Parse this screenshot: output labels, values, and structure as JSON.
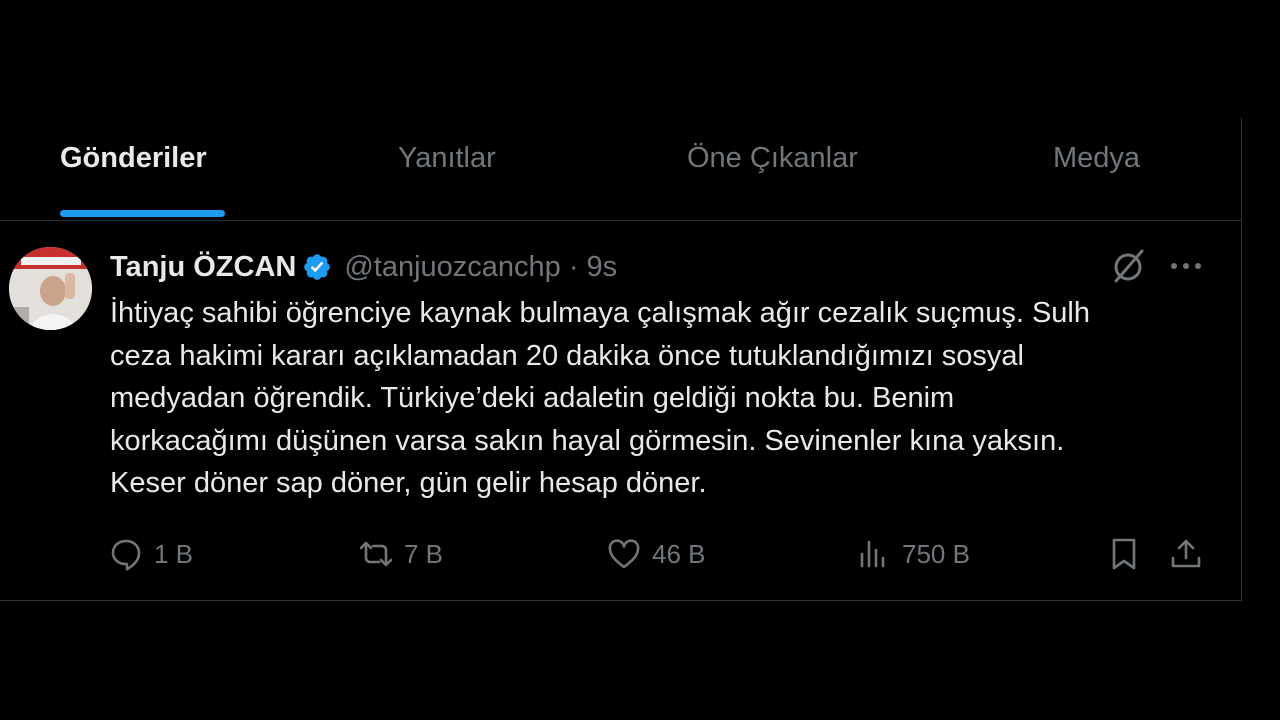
{
  "tabs": [
    {
      "label": "Gönderiler",
      "active": true
    },
    {
      "label": "Yanıtlar",
      "active": false
    },
    {
      "label": "Öne Çıkanlar",
      "active": false
    },
    {
      "label": "Medya",
      "active": false
    }
  ],
  "tweet": {
    "author": {
      "display_name": "Tanju ÖZCAN",
      "handle": "@tanjuozcanchp",
      "verified": true
    },
    "separator": "·",
    "time": "9s",
    "text_lines": [
      "İhtiyaç sahibi öğrenciye kaynak bulmaya çalışmak ağır cezalık suçmuş. Sulh",
      "ceza hakimi kararı açıklamadan 20 dakika önce tutuklandığımızı sosyal",
      "medyadan öğrendik. Türkiye’deki adaletin geldiği nokta bu. Benim",
      "korkacağımı düşünen varsa sakın hayal görmesin. Sevinenler kına yaksın.",
      "Keser döner sap döner, gün gelir hesap döner."
    ],
    "actions": {
      "replies": "1 B",
      "reposts": "7 B",
      "likes": "46 B",
      "views": "750 B"
    }
  },
  "colors": {
    "background": "#000000",
    "text_primary": "#e7e9ea",
    "text_secondary": "#71767b",
    "accent": "#1d9bf0",
    "border": "#2f3336"
  },
  "icons": [
    "verified-badge-icon",
    "grok-icon",
    "more-icon",
    "reply-icon",
    "repost-icon",
    "like-icon",
    "views-icon",
    "bookmark-icon",
    "share-icon"
  ]
}
